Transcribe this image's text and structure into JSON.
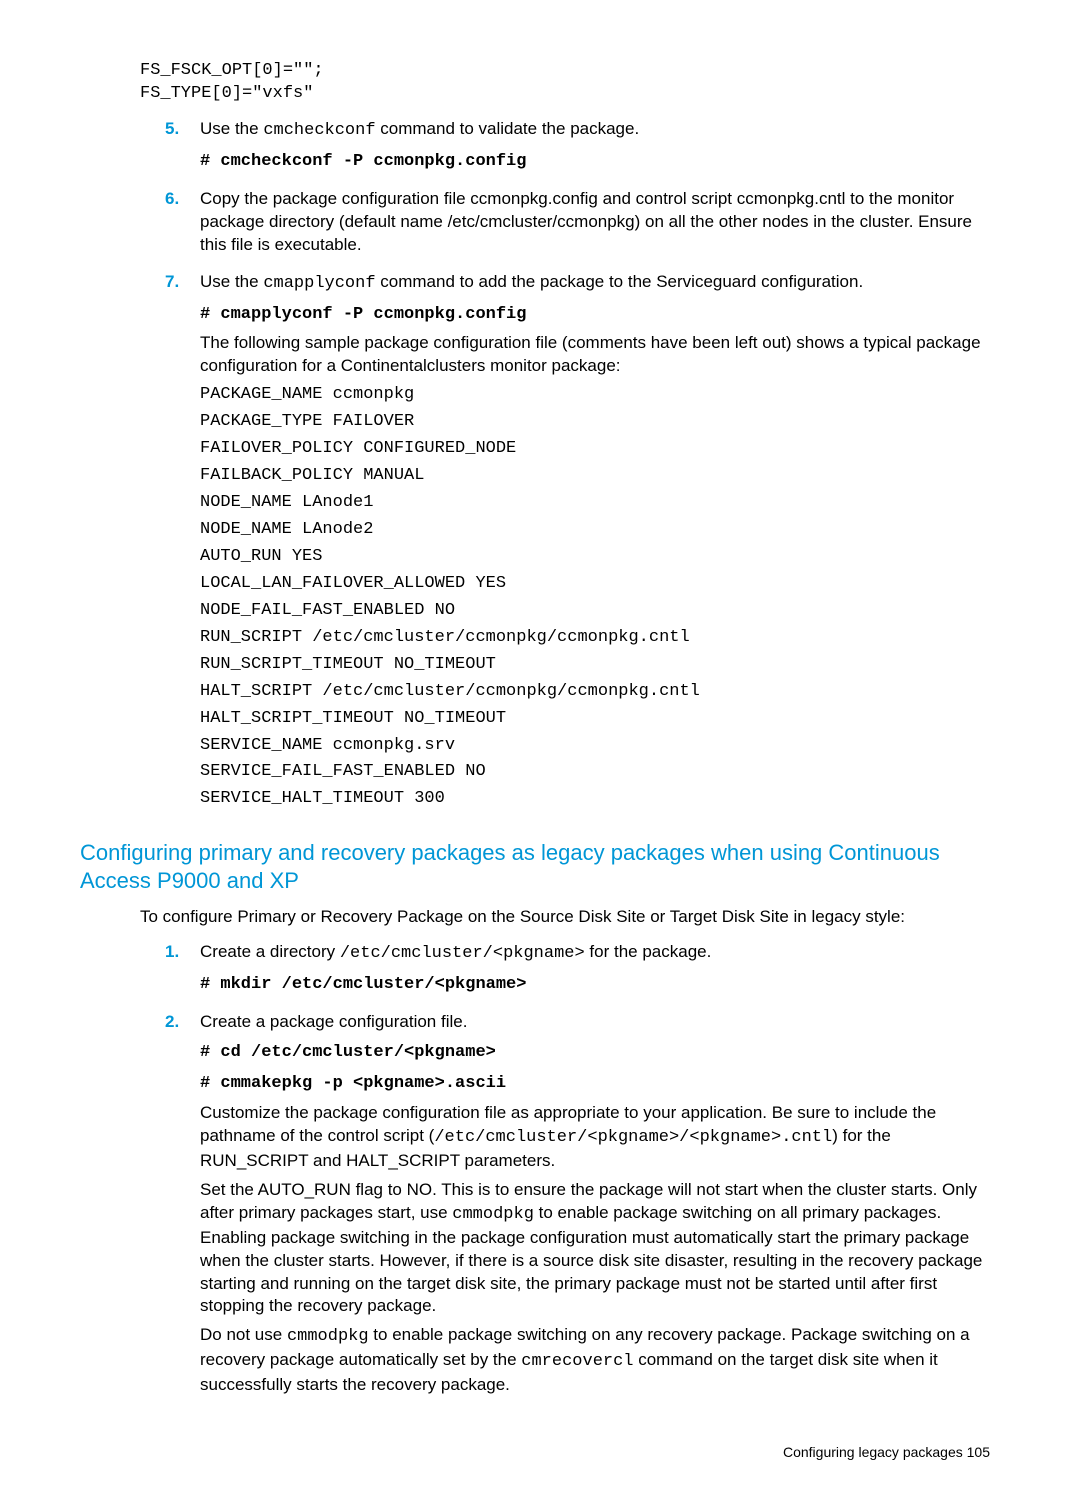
{
  "pre_top": "FS_FSCK_OPT[0]=\"\";\nFS_TYPE[0]=\"vxfs\"",
  "steps_a": [
    {
      "num": "5.",
      "paras": [
        [
          {
            "t": "Use the "
          },
          {
            "t": "cmcheckconf",
            "cls": "mono"
          },
          {
            "t": " command to validate the package."
          }
        ],
        [
          {
            "t": "# cmcheckconf -P ccmonpkg.config",
            "cls": "mono-bold"
          }
        ]
      ]
    },
    {
      "num": "6.",
      "paras": [
        [
          {
            "t": "Copy the package configuration file ccmonpkg.config and control script ccmonpkg.cntl to the monitor package directory (default name /etc/cmcluster/ccmonpkg) on all the other nodes in the cluster. Ensure this file is executable."
          }
        ]
      ]
    },
    {
      "num": "7.",
      "paras": [
        [
          {
            "t": "Use the "
          },
          {
            "t": "cmapplyconf",
            "cls": "mono"
          },
          {
            "t": " command to add the package to the Serviceguard configuration."
          }
        ],
        [
          {
            "t": "# cmapplyconf -P ccmonpkg.config",
            "cls": "mono-bold"
          }
        ],
        [
          {
            "t": "The following sample package configuration file (comments have been left out) shows a typical package configuration for a Continentalclusters monitor package:"
          }
        ]
      ],
      "code": [
        "PACKAGE_NAME ccmonpkg",
        "PACKAGE_TYPE FAILOVER",
        "FAILOVER_POLICY CONFIGURED_NODE",
        "FAILBACK_POLICY MANUAL",
        "NODE_NAME LAnode1",
        "NODE_NAME LAnode2",
        "AUTO_RUN YES",
        "LOCAL_LAN_FAILOVER_ALLOWED YES",
        "NODE_FAIL_FAST_ENABLED NO",
        "RUN_SCRIPT /etc/cmcluster/ccmonpkg/ccmonpkg.cntl",
        "RUN_SCRIPT_TIMEOUT NO_TIMEOUT",
        "HALT_SCRIPT /etc/cmcluster/ccmonpkg/ccmonpkg.cntl",
        "HALT_SCRIPT_TIMEOUT NO_TIMEOUT",
        "SERVICE_NAME ccmonpkg.srv",
        "SERVICE_FAIL_FAST_ENABLED NO",
        "SERVICE_HALT_TIMEOUT 300"
      ]
    }
  ],
  "h2": "Configuring primary and recovery packages as legacy packages when using Continuous Access P9000 and XP",
  "intro": "To configure Primary or Recovery Package on the Source Disk Site or Target Disk Site in legacy style:",
  "steps_b": [
    {
      "num": "1.",
      "paras": [
        [
          {
            "t": "Create a directory "
          },
          {
            "t": "/etc/cmcluster/<pkgname>",
            "cls": "mono"
          },
          {
            "t": " for the package."
          }
        ],
        [
          {
            "t": "# mkdir /etc/cmcluster/<pkgname>",
            "cls": "mono-bold"
          }
        ]
      ]
    },
    {
      "num": "2.",
      "paras": [
        [
          {
            "t": "Create a package configuration file."
          }
        ],
        [
          {
            "t": "# cd /etc/cmcluster/<pkgname>",
            "cls": "mono-bold"
          }
        ],
        [
          {
            "t": "# cmmakepkg -p <pkgname>.ascii",
            "cls": "mono-bold"
          }
        ],
        [
          {
            "t": "Customize the package configuration file as appropriate to your application. Be sure to include the pathname of the control script ("
          },
          {
            "t": "/etc/cmcluster/<pkgname>/<pkgname>.cntl",
            "cls": "mono"
          },
          {
            "t": ") for the RUN_SCRIPT and HALT_SCRIPT parameters."
          }
        ],
        [
          {
            "t": "Set the AUTO_RUN flag to NO. This is to ensure the package will not start when the cluster starts. Only after primary packages start, use "
          },
          {
            "t": "cmmodpkg",
            "cls": "mono"
          },
          {
            "t": " to enable package switching on all primary packages. Enabling package switching in the package configuration must automatically start the primary package when the cluster starts. However, if there is a source disk site disaster, resulting in the recovery package starting and running on the target disk site, the primary package must not be started until after first stopping the recovery package."
          }
        ],
        [
          {
            "t": "Do not use "
          },
          {
            "t": "cmmodpkg",
            "cls": "mono"
          },
          {
            "t": " to enable package switching on any recovery package. Package switching on a recovery package automatically set by the "
          },
          {
            "t": "cmrecovercl",
            "cls": "mono"
          },
          {
            "t": " command on the target disk site when it successfully starts the recovery package."
          }
        ]
      ]
    }
  ],
  "footer": "Configuring legacy packages   105"
}
